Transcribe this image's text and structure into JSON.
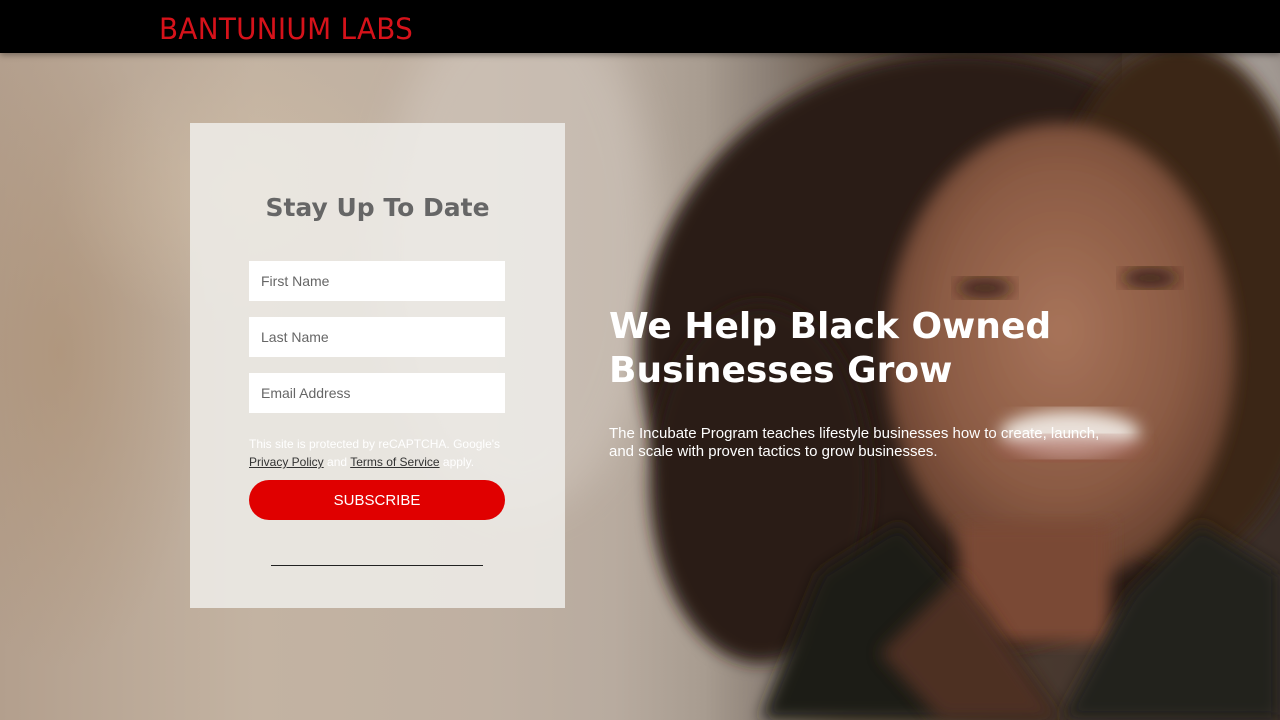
{
  "header": {
    "brand": "BANTUNIUM LABS"
  },
  "form": {
    "title": "Stay Up To Date",
    "first_name_placeholder": "First Name",
    "last_name_placeholder": "Last Name",
    "email_placeholder": "Email Address",
    "recaptcha_prefix": "This site is protected by reCAPTCHA. Google's",
    "privacy_link": "Privacy Policy",
    "and": "and",
    "terms_link": "Terms of Service",
    "apply": "apply.",
    "subscribe_label": "SUBSCRIBE"
  },
  "hero": {
    "headline": "We Help Black Owned Businesses Grow",
    "subtext": "The Incubate Program teaches lifestyle businesses how to create, launch, and scale with proven tactics to grow businesses."
  },
  "colors": {
    "brand_red": "#d6121a",
    "button_red": "#e00000",
    "topbar": "#000000"
  }
}
